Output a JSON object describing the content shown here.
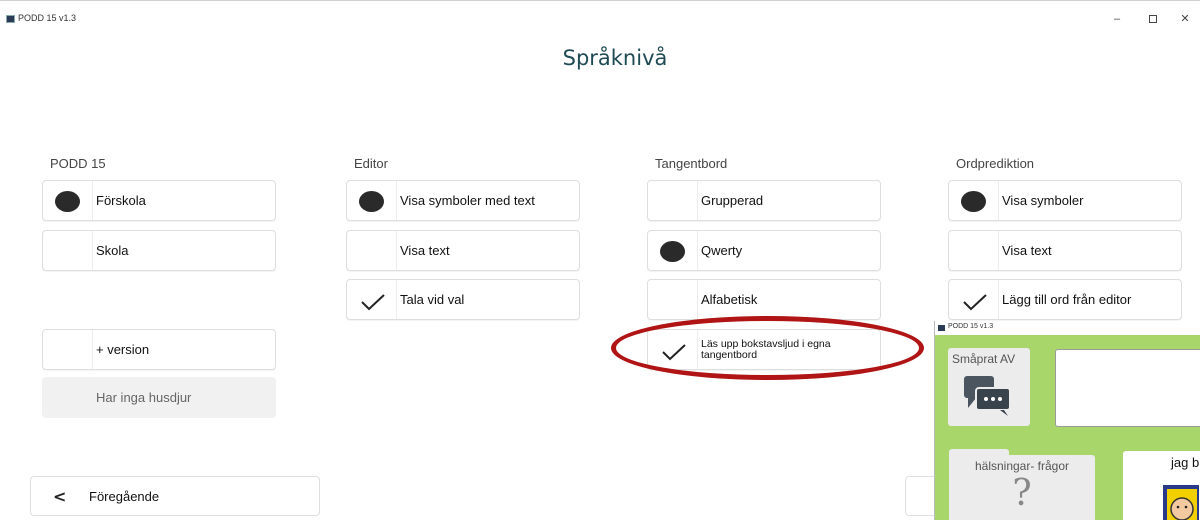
{
  "window": {
    "title": "PODD 15 v1.3",
    "minimize_glyph": "–",
    "close_glyph": "✕"
  },
  "page": {
    "title": "Språknivå"
  },
  "columns": {
    "podd": {
      "heading": "PODD 15",
      "options": [
        {
          "label": "Förskola",
          "state": "selected"
        },
        {
          "label": "Skola",
          "state": "none"
        }
      ],
      "extras": [
        {
          "label": "+ version",
          "state": "none"
        },
        {
          "label": "Har inga husdjur",
          "state": "disabled"
        }
      ]
    },
    "editor": {
      "heading": "Editor",
      "options": [
        {
          "label": "Visa symboler med text",
          "state": "selected"
        },
        {
          "label": "Visa text",
          "state": "none"
        },
        {
          "label": "Tala vid val",
          "state": "checked"
        }
      ]
    },
    "tangentbord": {
      "heading": "Tangentbord",
      "options": [
        {
          "label": "Grupperad",
          "state": "none"
        },
        {
          "label": "Qwerty",
          "state": "selected"
        },
        {
          "label": "Alfabetisk",
          "state": "none"
        },
        {
          "label": "Läs upp bokstavsljud i egna tangentbord",
          "state": "checked"
        }
      ]
    },
    "ordprediktion": {
      "heading": "Ordprediktion",
      "options": [
        {
          "label": "Visa symboler",
          "state": "selected"
        },
        {
          "label": "Visa text",
          "state": "none"
        },
        {
          "label": "Lägg till ord från editor",
          "state": "checked"
        }
      ]
    }
  },
  "footer": {
    "previous_label": "Föregående",
    "previous_glyph": "<"
  },
  "overlay": {
    "title": "PODD 15 v1.3",
    "tile_smaprat": "Småprat AV",
    "tile_halsningar": "hälsningar- frågor",
    "tile_halsningar_glyph": "?",
    "tile_jag": "jag b"
  },
  "colors": {
    "title": "#1e4a53",
    "highlight": "#b01414",
    "overlay_bg": "#a8d66a"
  }
}
